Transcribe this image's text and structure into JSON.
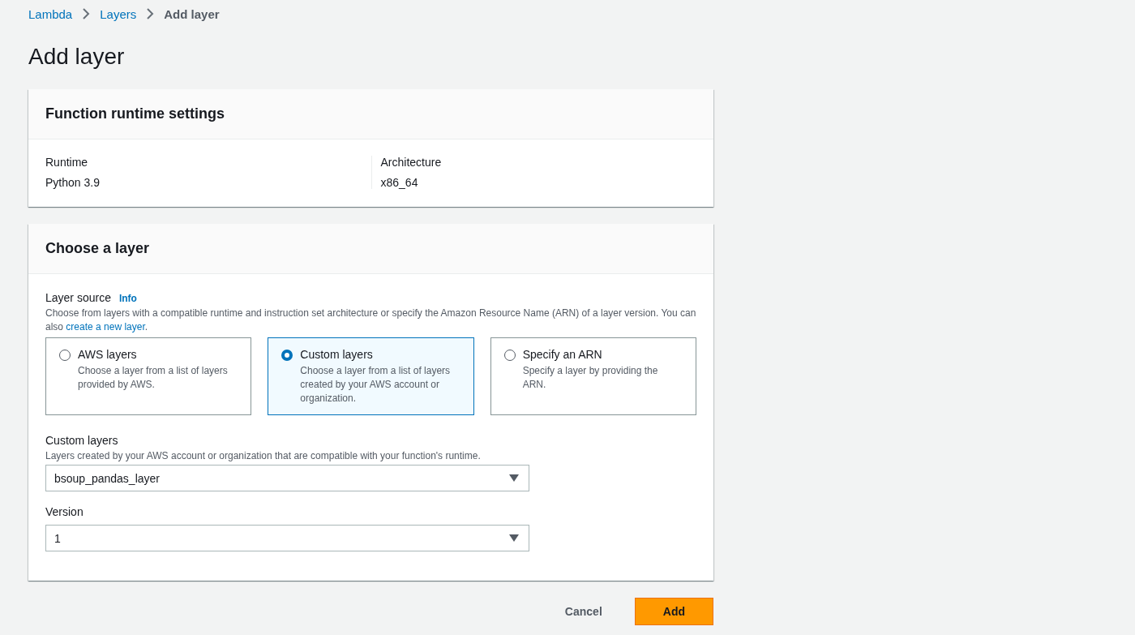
{
  "breadcrumbs": [
    {
      "label": "Lambda",
      "link": true
    },
    {
      "label": "Layers",
      "link": true
    },
    {
      "label": "Add layer",
      "link": false
    }
  ],
  "title": "Add layer",
  "runtime_settings": {
    "heading": "Function runtime settings",
    "fields": [
      {
        "label": "Runtime",
        "value": "Python 3.9"
      },
      {
        "label": "Architecture",
        "value": "x86_64"
      }
    ]
  },
  "choose_layer": {
    "heading": "Choose a layer",
    "layer_source": {
      "label": "Layer source",
      "info": "Info",
      "description": "Choose from layers with a compatible runtime and instruction set architecture or specify the Amazon Resource Name (ARN) of a layer version. You can also ",
      "description_link": "create a new layer",
      "description_end": ".",
      "options": [
        {
          "title": "AWS layers",
          "description": "Choose a layer from a list of layers provided by AWS.",
          "selected": false
        },
        {
          "title": "Custom layers",
          "description": "Choose a layer from a list of layers created by your AWS account or organization.",
          "selected": true
        },
        {
          "title": "Specify an ARN",
          "description": "Specify a layer by providing the ARN.",
          "selected": false
        }
      ]
    },
    "selects": [
      {
        "label": "Custom layers",
        "hint": "Layers created by your AWS account or organization that are compatible with your function's runtime.",
        "value": "bsoup_pandas_layer"
      },
      {
        "label": "Version",
        "value": "1"
      }
    ]
  },
  "buttons": [
    {
      "label": "Cancel",
      "kind": "link"
    },
    {
      "label": "Add",
      "kind": "primary"
    }
  ]
}
